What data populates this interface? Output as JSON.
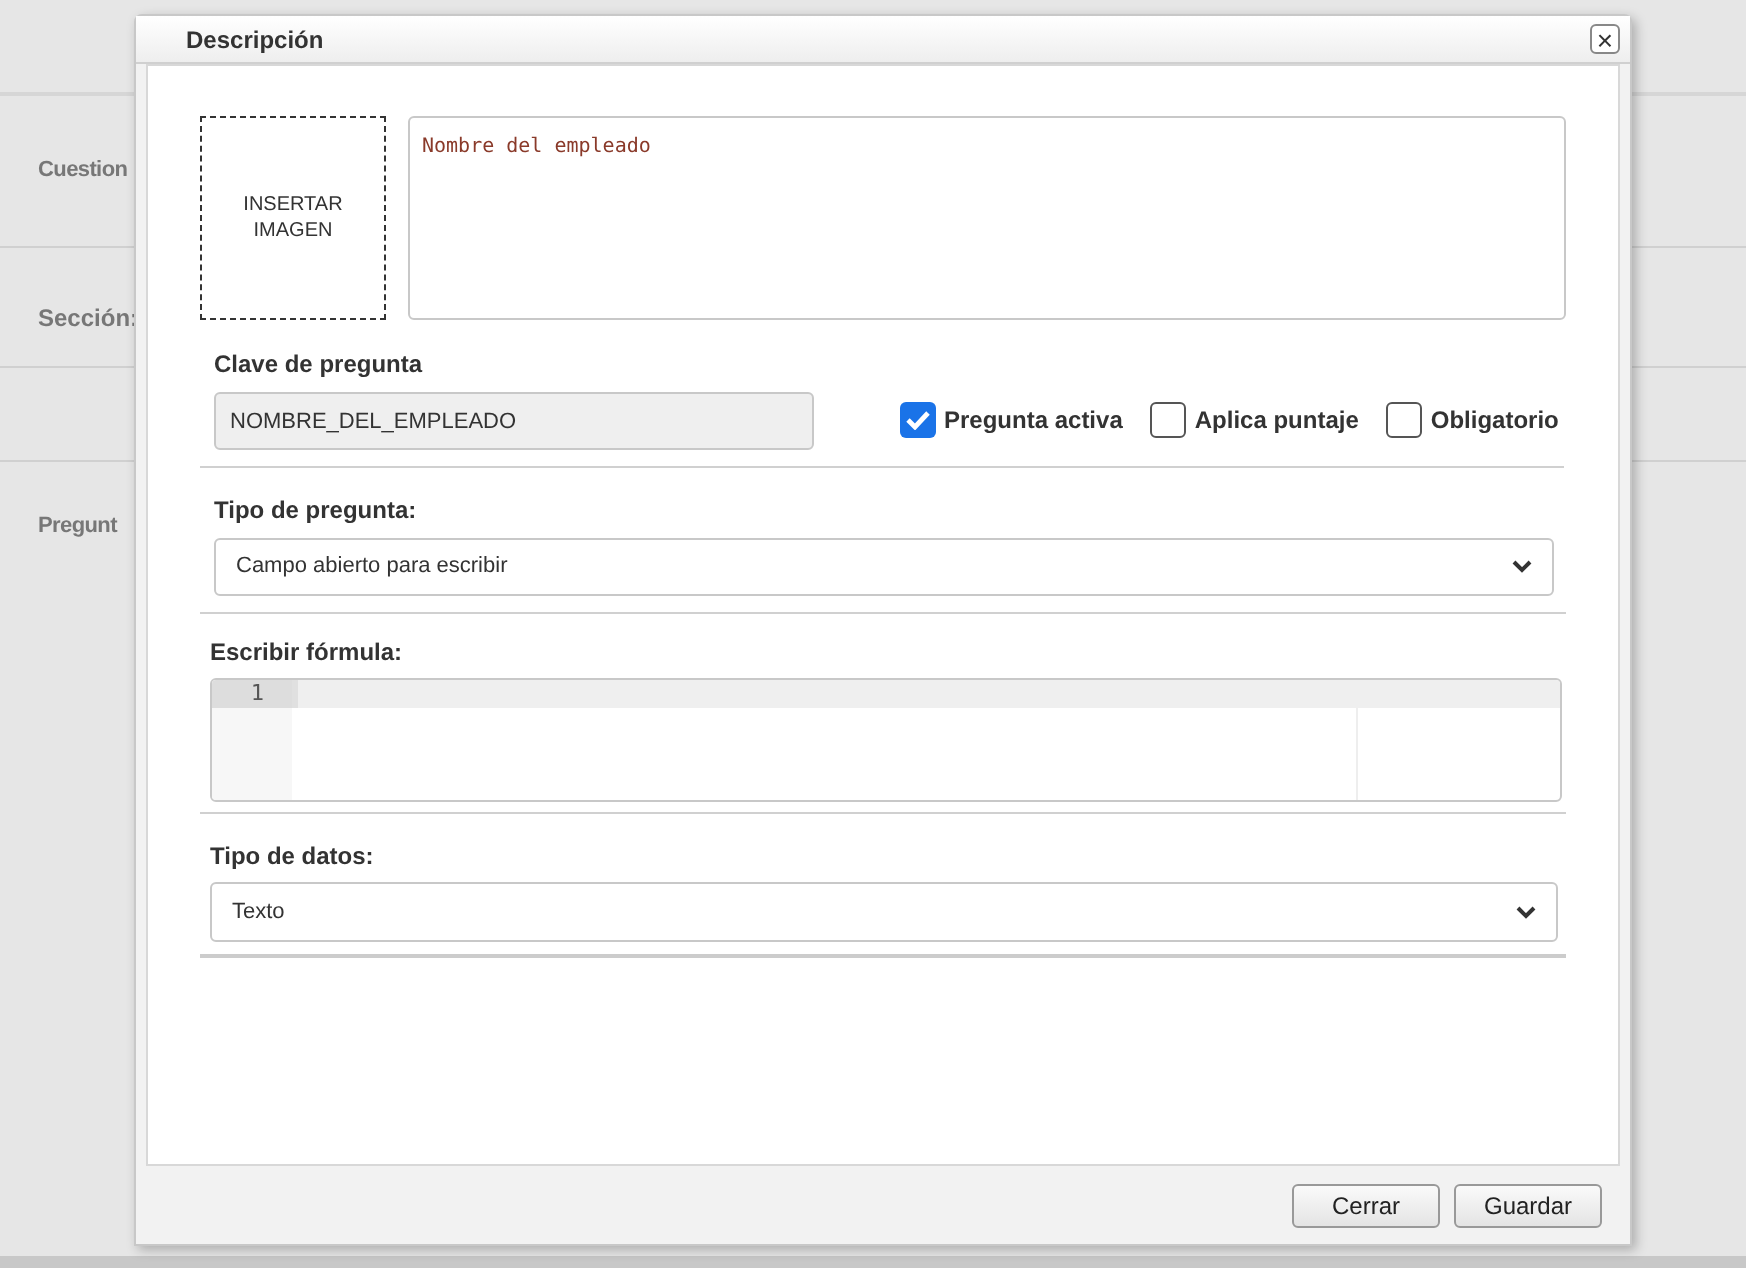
{
  "background": {
    "labels": [
      "Cuestion",
      "Sección:",
      "Pregunt"
    ]
  },
  "dialog": {
    "title": "Descripción",
    "close": "×",
    "image_placeholder": "INSERTAR IMAGEN",
    "description": "Nombre del empleado",
    "key": {
      "label": "Clave de pregunta",
      "value": "NOMBRE_DEL_EMPLEADO"
    },
    "checkboxes": [
      {
        "label": "Pregunta activa",
        "checked": true
      },
      {
        "label": "Aplica puntaje",
        "checked": false
      },
      {
        "label": "Obligatorio",
        "checked": false
      }
    ],
    "question_type": {
      "label": "Tipo de pregunta:",
      "value": "Campo abierto para escribir"
    },
    "formula": {
      "label": "Escribir fórmula:",
      "line_numbers": [
        "1"
      ]
    },
    "data_type": {
      "label": "Tipo de datos:",
      "value": "Texto"
    },
    "buttons": [
      "Cerrar",
      "Guardar"
    ]
  }
}
